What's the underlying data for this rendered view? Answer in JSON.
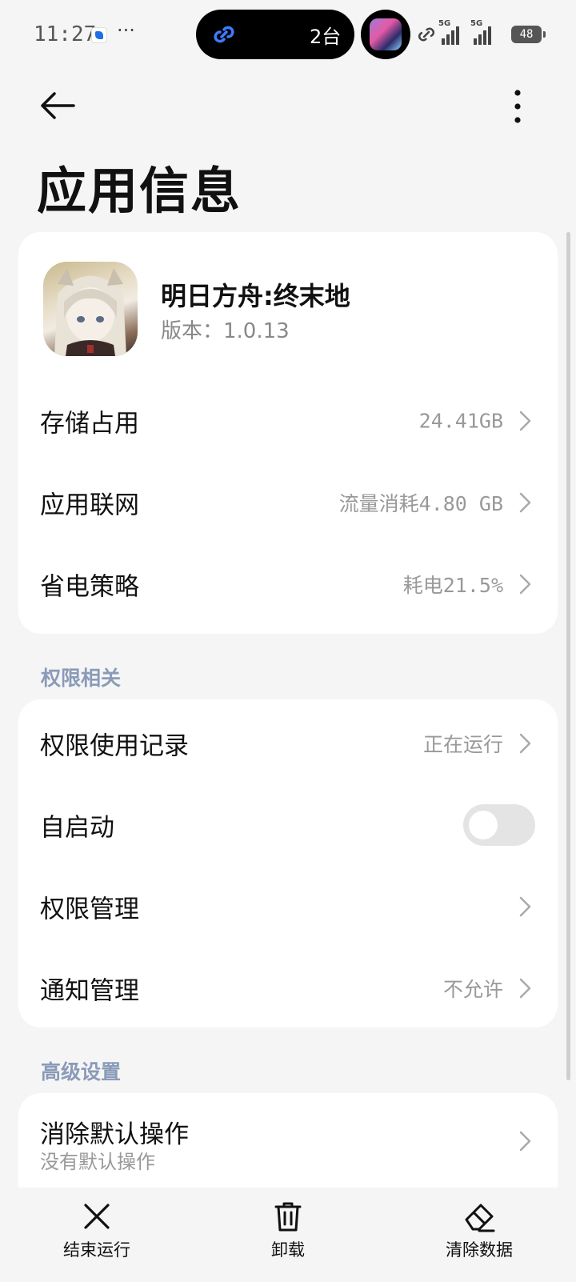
{
  "status_bar": {
    "time": "11:27",
    "overflow": "···",
    "island_text": "2台",
    "network_label_1": "5G",
    "network_label_2": "5G",
    "battery": "48"
  },
  "header": {
    "title": "应用信息"
  },
  "app": {
    "name": "明日方舟:终末地",
    "version": "版本：1.0.13"
  },
  "info_rows": [
    {
      "label": "存储占用",
      "value": "24.41GB"
    },
    {
      "label": "应用联网",
      "value": "流量消耗4.80 GB"
    },
    {
      "label": "省电策略",
      "value": "耗电21.5%"
    }
  ],
  "permissions": {
    "section_title": "权限相关",
    "rows": [
      {
        "label": "权限使用记录",
        "value": "正在运行"
      },
      {
        "label": "自启动",
        "toggle": false
      },
      {
        "label": "权限管理",
        "value": ""
      },
      {
        "label": "通知管理",
        "value": "不允许"
      }
    ]
  },
  "advanced": {
    "section_title": "高级设置",
    "rows": [
      {
        "label": "消除默认操作",
        "sublabel": "没有默认操作"
      }
    ]
  },
  "bottom_bar": {
    "force_stop": "结束运行",
    "uninstall": "卸载",
    "clear_data": "清除数据"
  },
  "colors": {
    "background": "#f5f5f5",
    "card": "#ffffff",
    "section_title": "#8a9bb8",
    "secondary_text": "#999999"
  }
}
